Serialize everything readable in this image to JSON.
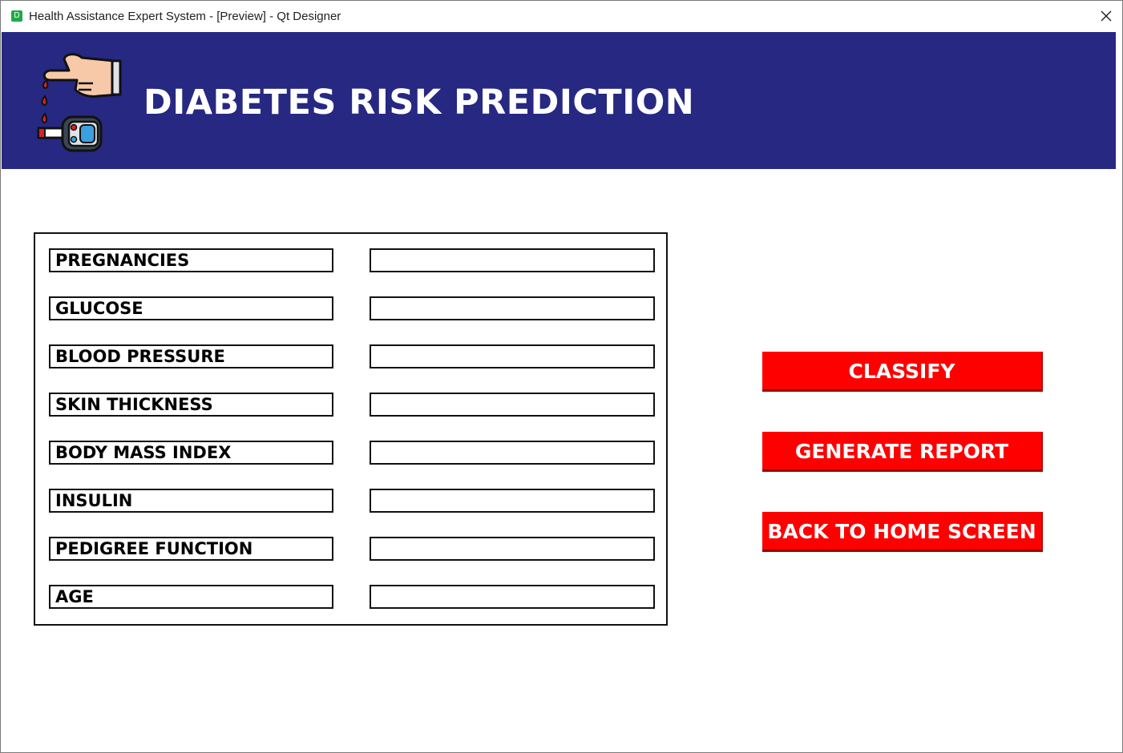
{
  "window": {
    "app_icon_letter": "D",
    "title": "Health Assistance Expert System - [Preview] - Qt Designer"
  },
  "header": {
    "title": "DIABETES RISK PREDICTION",
    "icon": "glucose-meter-finger-prick-icon",
    "background_color": "#262882"
  },
  "form": {
    "fields": [
      {
        "label": "PREGNANCIES",
        "value": ""
      },
      {
        "label": "GLUCOSE",
        "value": ""
      },
      {
        "label": "BLOOD PRESSURE",
        "value": ""
      },
      {
        "label": "SKIN THICKNESS",
        "value": ""
      },
      {
        "label": "BODY MASS INDEX",
        "value": ""
      },
      {
        "label": "INSULIN",
        "value": ""
      },
      {
        "label": "PEDIGREE FUNCTION",
        "value": ""
      },
      {
        "label": "AGE",
        "value": ""
      }
    ]
  },
  "actions": {
    "classify_label": "CLASSIFY",
    "generate_report_label": "GENERATE REPORT",
    "back_home_label": "BACK TO HOME SCREEN",
    "button_color": "#ff0000"
  }
}
